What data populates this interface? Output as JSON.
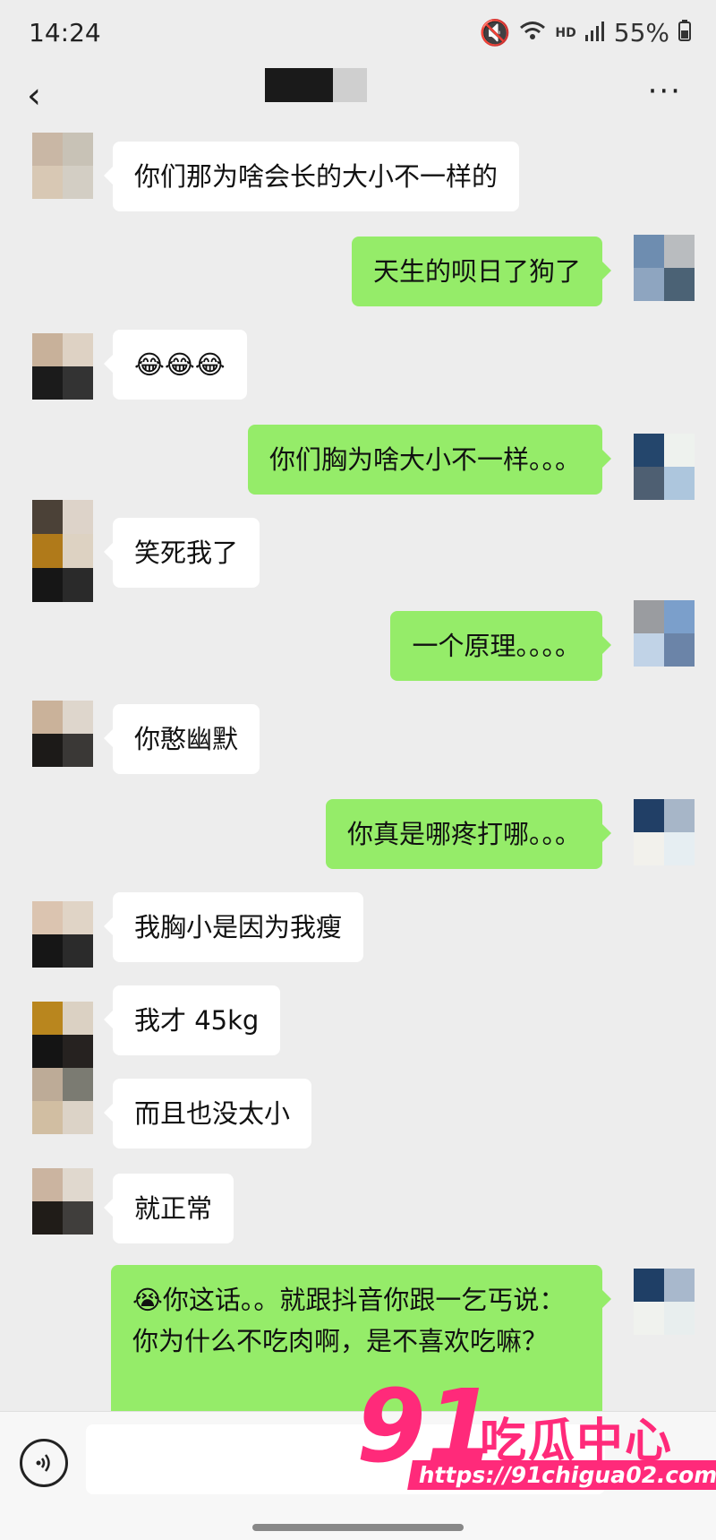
{
  "status_bar": {
    "time": "14:24",
    "network": "HD",
    "battery": "55%"
  },
  "header": {
    "back_icon": "chevron-left-icon",
    "more_label": "···"
  },
  "messages": [
    {
      "side": "left",
      "text": "你们那为啥会长的大小不一样的"
    },
    {
      "side": "right",
      "text": "天生的呗日了狗了"
    },
    {
      "side": "left",
      "text": "😂😂😂"
    },
    {
      "side": "right",
      "text": "你们胸为啥大小不一样。。。"
    },
    {
      "side": "left",
      "text": "笑死我了"
    },
    {
      "side": "right",
      "text": "一个原理。。。。"
    },
    {
      "side": "left",
      "text": "你憨幽默"
    },
    {
      "side": "right",
      "text": "你真是哪疼打哪。。。"
    },
    {
      "side": "left",
      "text": "我胸小是因为我瘦"
    },
    {
      "side": "left",
      "text": "我才 45kg"
    },
    {
      "side": "left",
      "text": "而且也没太小"
    },
    {
      "side": "left",
      "text": "就正常"
    },
    {
      "side": "right",
      "text": "😭你这话。。就跟抖音你跟一乞丐说：你为什么不吃肉啊，是不喜欢吃嘛？"
    }
  ],
  "input_bar": {
    "voice_icon": "voice-icon"
  },
  "watermark": {
    "number": "91",
    "text": "吃瓜中心",
    "url": "https://91chigua02.com"
  }
}
